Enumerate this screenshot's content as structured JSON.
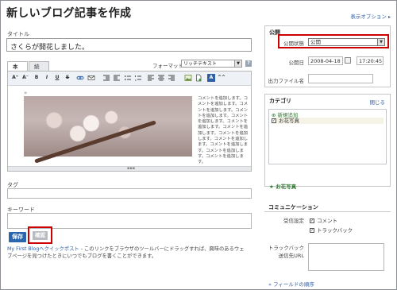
{
  "header": {
    "title": "新しいブログ記事を作成",
    "display_options": "表示オプション"
  },
  "title_field": {
    "label": "タイトル",
    "value": "さくらが開花しました。"
  },
  "editor": {
    "tabs": [
      "本文",
      "続き"
    ],
    "format_label": "フォーマット:",
    "format_value": "リッチテキスト",
    "help_label": "?",
    "toolbar": [
      "A⁺",
      "A⁻",
      "B",
      "I",
      "U",
      "S",
      "",
      "",
      "",
      "",
      "",
      "",
      "",
      "",
      "",
      "",
      "",
      "A",
      "^^"
    ],
    "cursor_mark": "»",
    "sample_text": "コメントを追加します。コメントを追加します。コメントを追加します。コメントを追加します。コメントを追加します。コメントを追加します。コメントを追加します。コメントを追加します。コメントを追加します。コメントを追加します。コメントを追加します。コメントを追加します。"
  },
  "tag": {
    "label": "タグ"
  },
  "keywords": {
    "label": "キーワード"
  },
  "actions": {
    "save": "保存",
    "confirm": "確認"
  },
  "bookmark_note": {
    "link": "My First Blogへクイックポスト",
    "text": " - このリンクをブラウザのツールバーにドラッグすれば、興味のあるウェブページを見つけたときにいつでもブログを書くことができます。"
  },
  "publish": {
    "title": "公開",
    "status_label": "公開状態",
    "status_value": "公開",
    "date_label": "公開日",
    "date_value": "2008-04-18",
    "time_value": "17:20:45",
    "file_label": "出力ファイル名"
  },
  "category": {
    "title": "カテゴリ",
    "close": "閉じる",
    "add": "新規追加",
    "item": "お花写真",
    "selected": "お花写真"
  },
  "communication": {
    "title": "コミュニケーション",
    "accept_label": "受信設定",
    "comment": "コメント",
    "trackback": "トラックバック",
    "trackback_send_label": "トラックバック",
    "trackback_send_label2": "送信先URL"
  },
  "field_order": "フィールドの順序",
  "colors": {
    "accent": "#2f5fa5",
    "highlight": "#cc0000",
    "save": "#2a66ad"
  }
}
